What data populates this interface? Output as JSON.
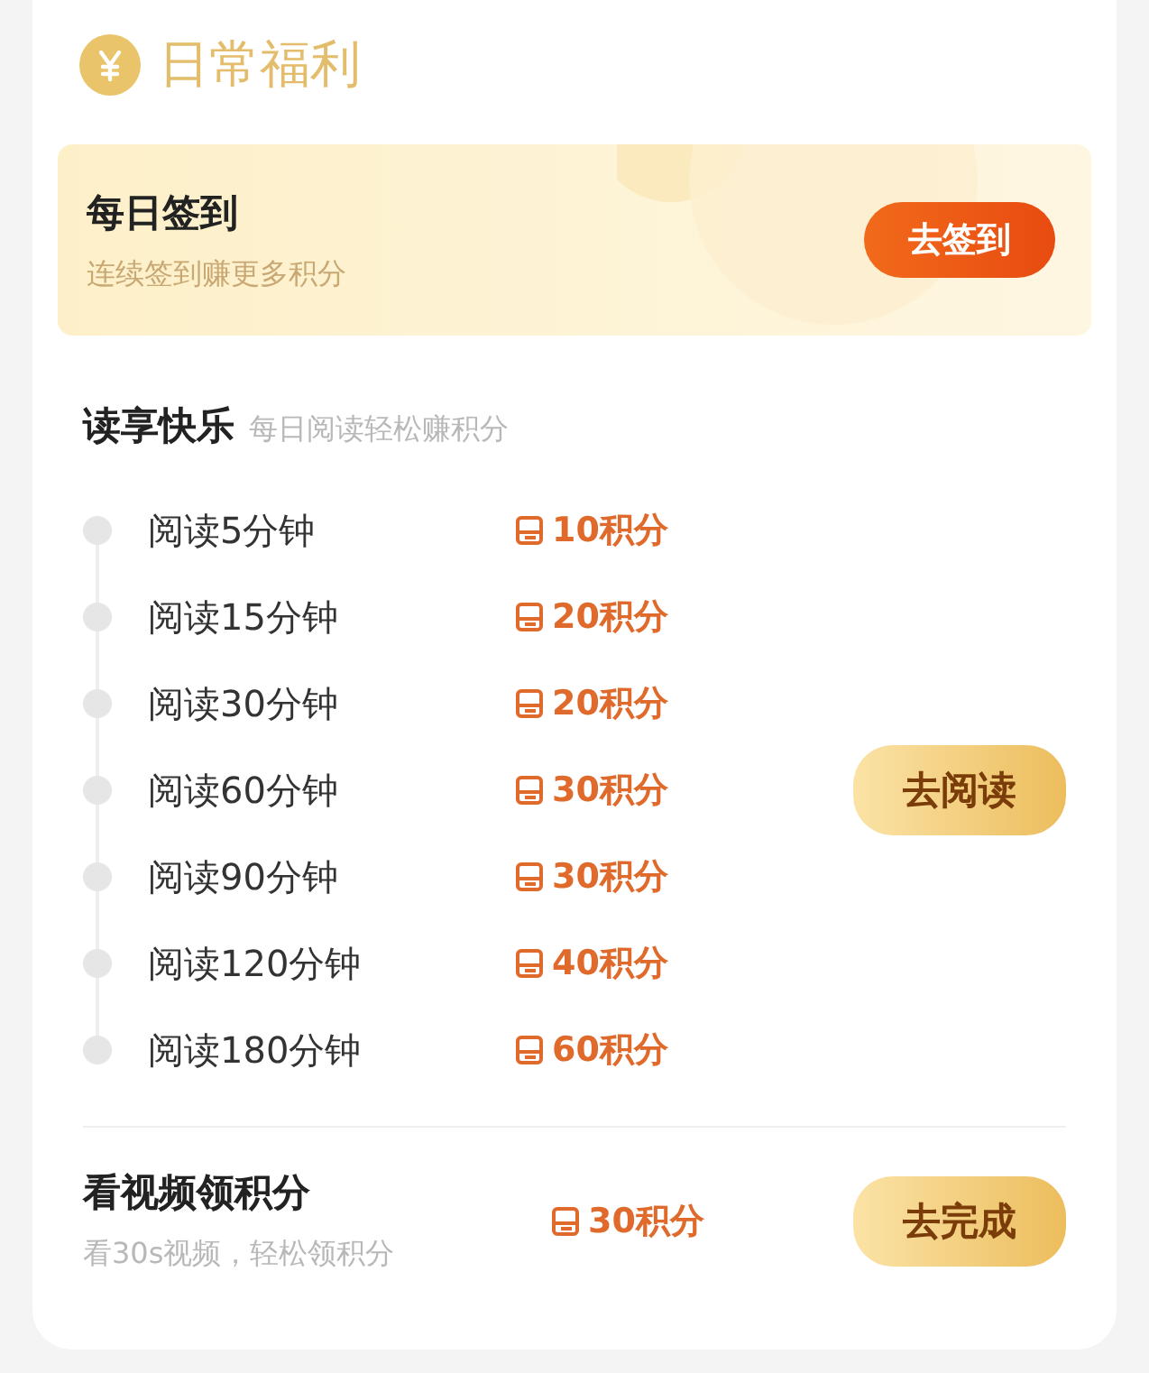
{
  "header": {
    "title": "日常福利"
  },
  "checkin": {
    "title": "每日签到",
    "subtitle": "连续签到赚更多积分",
    "button": "去签到"
  },
  "reading": {
    "title": "读享快乐",
    "subtitle": "每日阅读轻松赚积分",
    "button": "去阅读",
    "tasks": [
      {
        "label": "阅读5分钟",
        "points": "10积分"
      },
      {
        "label": "阅读15分钟",
        "points": "20积分"
      },
      {
        "label": "阅读30分钟",
        "points": "20积分"
      },
      {
        "label": "阅读60分钟",
        "points": "30积分"
      },
      {
        "label": "阅读90分钟",
        "points": "30积分"
      },
      {
        "label": "阅读120分钟",
        "points": "40积分"
      },
      {
        "label": "阅读180分钟",
        "points": "60积分"
      }
    ]
  },
  "video": {
    "title": "看视频领积分",
    "subtitle": "看30s视频，轻松领积分",
    "points": "30积分",
    "button": "去完成"
  }
}
